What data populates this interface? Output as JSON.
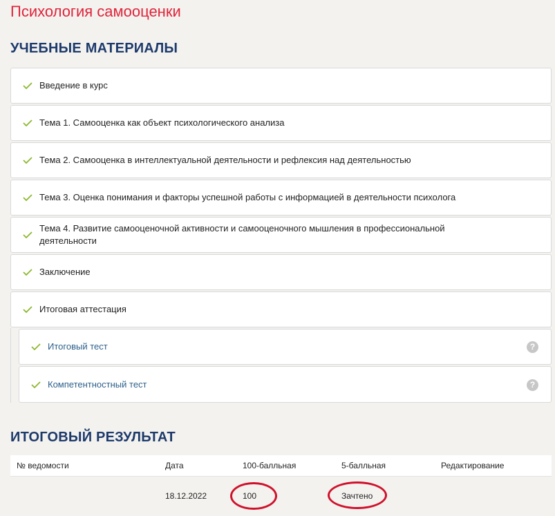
{
  "page": {
    "title": "Психология самооценки"
  },
  "materials": {
    "heading": "УЧЕБНЫЕ МАТЕРИАЛЫ",
    "items": [
      {
        "label": "Введение в курс"
      },
      {
        "label": "Тема 1. Самооценка как объект психологического анализа"
      },
      {
        "label": "Тема 2. Самооценка в интеллектуальной деятельности и рефлексия над деятельностью"
      },
      {
        "label": "Тема 3. Оценка понимания и факторы успешной работы с информацией в деятельности психолога"
      },
      {
        "label": "Тема 4. Развитие самооценочной активности и самооценочного мышления в профессиональной деятельности"
      },
      {
        "label": "Заключение"
      },
      {
        "label": "Итоговая аттестация"
      }
    ],
    "sub_items": [
      {
        "label": "Итоговый тест",
        "help": "?"
      },
      {
        "label": "Компетентностный тест",
        "help": "?"
      }
    ]
  },
  "results": {
    "heading": "ИТОГОВЫЙ РЕЗУЛЬТАТ",
    "columns": [
      "№ ведомости",
      "Дата",
      "100-балльная",
      "5-балльная",
      "Редактирование"
    ],
    "rows": [
      {
        "number": "",
        "date": "18.12.2022",
        "score100": "100",
        "score5": "Зачтено",
        "edit": ""
      }
    ]
  },
  "colors": {
    "title": "#e0243a",
    "heading": "#1d3a6b",
    "check": "#8cb82e",
    "sub_link": "#2c5f8a",
    "annotation": "#d0112b"
  },
  "icons": {
    "check": "check-icon",
    "help": "help-icon"
  }
}
